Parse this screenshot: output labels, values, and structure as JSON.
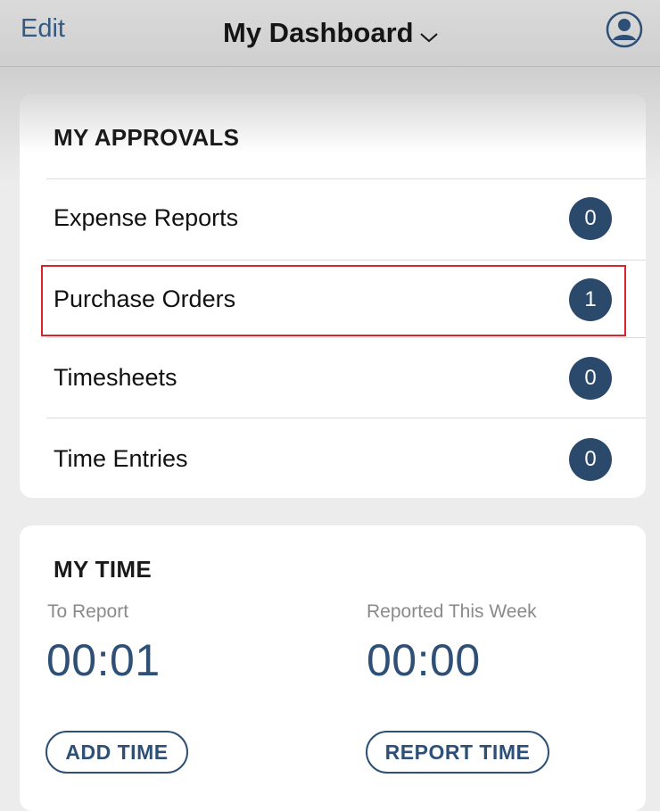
{
  "nav": {
    "edit_label": "Edit",
    "title": "My Dashboard",
    "dropdown_icon": "chevron-down-icon",
    "profile_icon": "person-circle-icon"
  },
  "approvals": {
    "title": "MY APPROVALS",
    "items": [
      {
        "label": "Expense Reports",
        "count": "0"
      },
      {
        "label": "Purchase Orders",
        "count": "1"
      },
      {
        "label": "Timesheets",
        "count": "0"
      },
      {
        "label": "Time Entries",
        "count": "0"
      }
    ],
    "highlighted_item": "Purchase Orders"
  },
  "my_time": {
    "title": "MY TIME",
    "to_report_label": "To Report",
    "to_report_value": "00:01",
    "reported_label": "Reported This Week",
    "reported_value": "00:00",
    "add_time_label": "ADD TIME",
    "report_time_label": "REPORT TIME"
  },
  "colors": {
    "accent": "#2e5077",
    "badge": "#2b4a6b",
    "highlight": "#d9232f"
  }
}
